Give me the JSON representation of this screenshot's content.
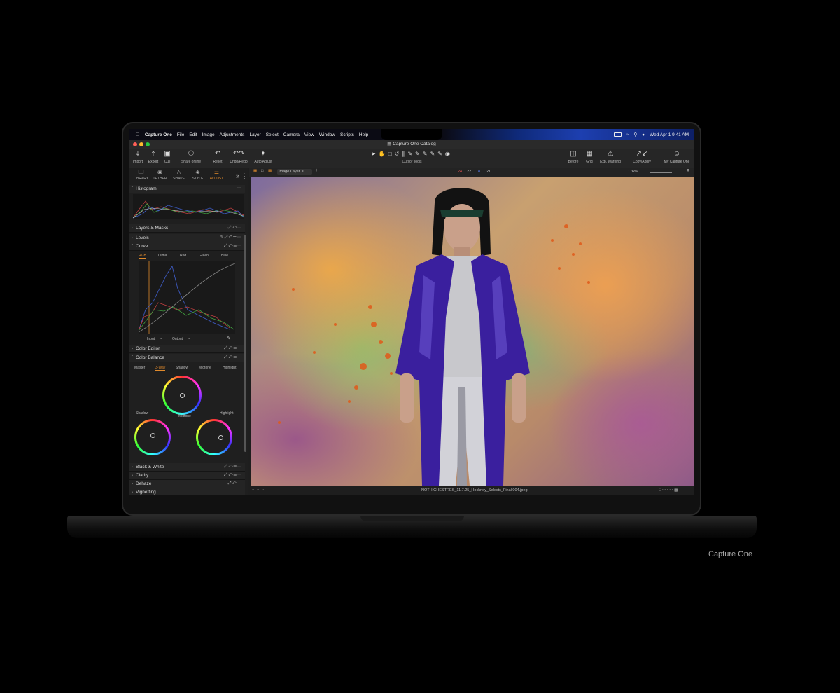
{
  "menubar": {
    "items": [
      "Capture One",
      "File",
      "Edit",
      "Image",
      "Adjustments",
      "Layer",
      "Select",
      "Camera",
      "View",
      "Window",
      "Scripts",
      "Help"
    ],
    "datetime": "Wed Apr 1  9:41 AM"
  },
  "window": {
    "title": "Capture One Catalog"
  },
  "toolbar": {
    "import": "Import",
    "export": "Export",
    "cull": "Cull",
    "share": "Share online",
    "reset": "Reset",
    "undo_redo": "Undo/Redo",
    "auto_adjust": "Auto Adjust",
    "cursor_tools": "Cursor Tools",
    "before": "Before",
    "grid": "Grid",
    "exp_warning": "Exp. Warning",
    "copy_apply": "Copy/Apply",
    "my_capture_one": "My Capture One"
  },
  "tabs": [
    "LIBRARY",
    "TETHER",
    "SHAPE",
    "STYLE",
    "ADJUST"
  ],
  "panel": {
    "histogram": "Histogram",
    "layers_masks": "Layers & Masks",
    "levels": "Levels",
    "curve": "Curve",
    "curve_channels": [
      "RGB",
      "Luma",
      "Red",
      "Green",
      "Blue"
    ],
    "curve_input": "Input:",
    "curve_input_val": "--",
    "curve_output": "Output:",
    "curve_output_val": "--",
    "color_editor": "Color Editor",
    "color_balance": "Color Balance",
    "cb_modes": [
      "Master",
      "3-Way",
      "Shadow",
      "Midtone",
      "Highlight"
    ],
    "cb_shadow": "Shadow",
    "cb_midtone": "Midtone",
    "cb_highlight": "Highlight",
    "black_white": "Black & White",
    "clarity": "Clarity",
    "dehaze": "Dehaze",
    "vignetting": "Vignetting"
  },
  "viewer": {
    "layer_select": "Image Layer",
    "counts": [
      "24",
      "22",
      "8",
      "21"
    ],
    "zoom": "176%",
    "filename": "NOTHIGHESTRES_11.7.25_Hockney_Selects_Final.004.jpeg"
  },
  "caption": "Capture One",
  "colors": {
    "accent": "#e08a2c",
    "panel_bg": "#1f1f1f",
    "purple_coat": "#3a1f9e"
  }
}
